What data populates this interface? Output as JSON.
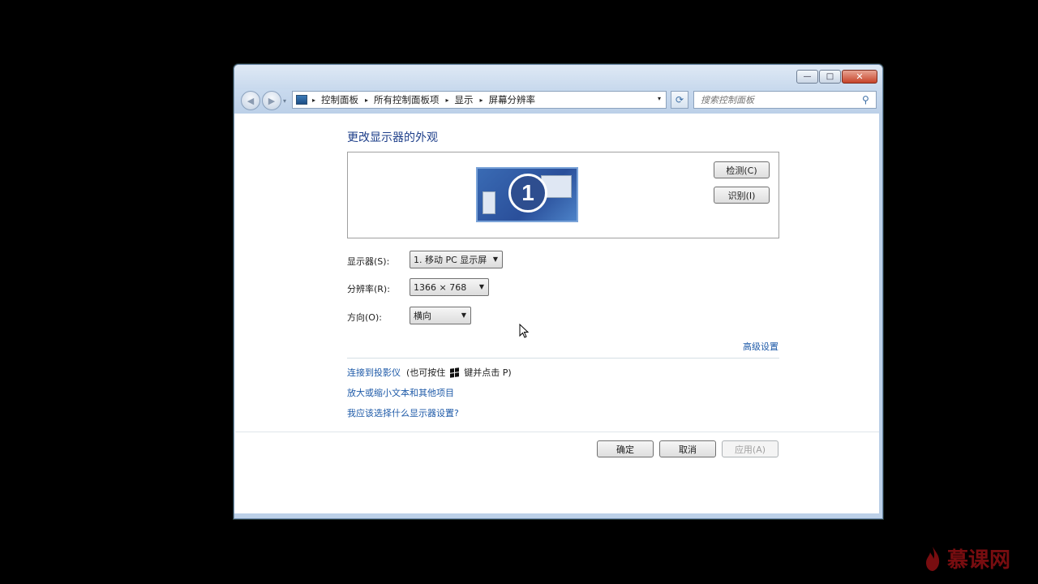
{
  "window": {
    "minimize_glyph": "—",
    "maximize_glyph": "□",
    "close_glyph": "✕"
  },
  "nav": {
    "back_glyph": "◀",
    "forward_glyph": "▶",
    "dropdown_glyph": "▾",
    "breadcrumbs": [
      "控制面板",
      "所有控制面板项",
      "显示",
      "屏幕分辨率"
    ],
    "separator": "▸",
    "refresh_glyph": "⟳",
    "search_placeholder": "搜索控制面板",
    "search_glyph": "⚲"
  },
  "main": {
    "title": "更改显示器的外观",
    "monitor_number": "1",
    "detect_label": "检测(C)",
    "identify_label": "识别(I)",
    "display_label": "显示器(S):",
    "display_value": "1. 移动 PC 显示屏",
    "resolution_label": "分辨率(R):",
    "resolution_value": "1366 × 768",
    "orientation_label": "方向(O):",
    "orientation_value": "横向",
    "advanced_link": "高级设置",
    "projector_link": "连接到投影仪",
    "projector_hint_prefix": "(也可按住",
    "projector_hint_suffix": "键并点击 P)",
    "text_size_link": "放大或缩小文本和其他项目",
    "which_settings_link": "我应该选择什么显示器设置?"
  },
  "footer": {
    "ok_label": "确定",
    "cancel_label": "取消",
    "apply_label": "应用(A)"
  },
  "watermark": {
    "text": "慕课网"
  },
  "colors": {
    "link": "#1e5aa8",
    "heading": "#1e3f8a",
    "watermark": "#c9161c"
  }
}
